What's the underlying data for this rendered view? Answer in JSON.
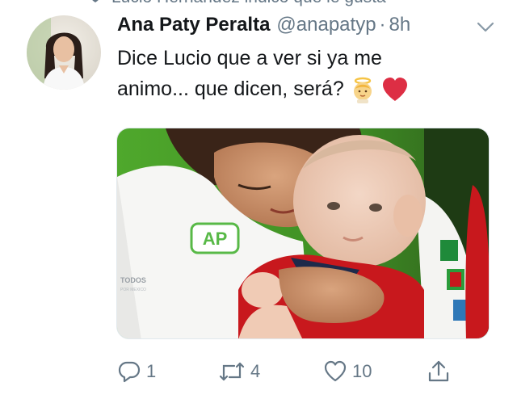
{
  "context": {
    "text": "Lucio Hernández indicó que le gusta"
  },
  "tweet": {
    "name": "Ana Paty Peralta",
    "handle": "@anapatyp",
    "separator": "·",
    "time": "8h",
    "text_line1": "Dice Lucio que a ver si ya me",
    "text_line2": "animo... que dicen, será?",
    "emojis": [
      "baby-angel",
      "red-heart"
    ],
    "media": {
      "badge_text": "AP",
      "shirt_text": "TODOS",
      "shirt_subtext": "POR MEXICO"
    }
  },
  "actions": {
    "replies": "1",
    "retweets": "4",
    "likes": "10"
  },
  "icons": [
    "like-context-icon",
    "caret-down-icon",
    "reply-icon",
    "retweet-icon",
    "like-icon",
    "share-icon"
  ],
  "colors": {
    "text_primary": "#14171a",
    "text_secondary": "#657786",
    "heart_red": "#e0245e",
    "shirt_red": "#c8181d",
    "badge_green": "#58b947"
  }
}
